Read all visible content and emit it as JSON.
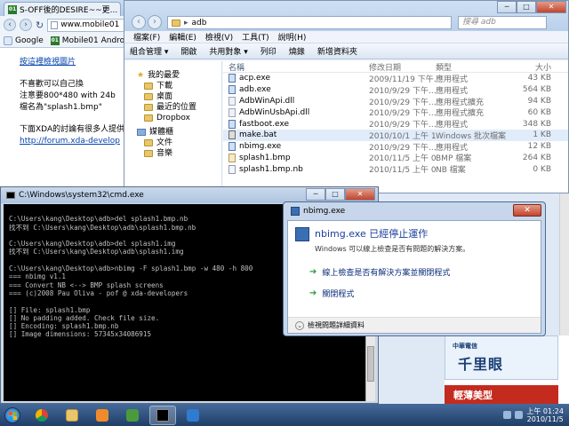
{
  "browser": {
    "tab_title": "S-OFF後的DESIRE~~更...",
    "tab_favicon": "01",
    "url": "www.mobile01",
    "bookmarks": [
      {
        "label": "Google",
        "icon": "google-icon"
      },
      {
        "label": "Mobile01 Android",
        "icon": "mobile01-icon"
      }
    ],
    "content": {
      "link1": "按這裡檢視圖片",
      "line1": "不喜歡可以自己換",
      "line2": "注意要800*480 with 24b",
      "line3": "檔名為\"splash1.bmp\"",
      "line4": "下面XDA的討論有很多人提供",
      "link2": "http://forum.xda-develop"
    }
  },
  "explorer": {
    "path": "adb",
    "search_placeholder": "搜尋 adb",
    "menu": [
      "檔案(F)",
      "編輯(E)",
      "檢視(V)",
      "工具(T)",
      "說明(H)"
    ],
    "commands": [
      "組合管理 ▾",
      "開啟",
      "共用對象 ▾",
      "列印",
      "燒錄",
      "新增資料夾"
    ],
    "nav": [
      {
        "label": "我的最愛",
        "icon": "star-icon",
        "sub": false
      },
      {
        "label": "下載",
        "icon": "folder-icon",
        "sub": true
      },
      {
        "label": "桌面",
        "icon": "folder-icon",
        "sub": true
      },
      {
        "label": "最近的位置",
        "icon": "folder-icon",
        "sub": true
      },
      {
        "label": "Dropbox",
        "icon": "folder-icon",
        "sub": true
      },
      {
        "label": "媒體櫃",
        "icon": "library-icon",
        "sub": false
      },
      {
        "label": "文件",
        "icon": "folder-icon",
        "sub": true
      },
      {
        "label": "音樂",
        "icon": "folder-icon",
        "sub": true
      }
    ],
    "columns": {
      "name": "名稱",
      "date": "修改日期",
      "type": "類型",
      "size": "大小"
    },
    "files": [
      {
        "name": "acp.exe",
        "date": "2009/11/19 下午...",
        "type": "應用程式",
        "size": "43 KB",
        "kind": "exe"
      },
      {
        "name": "adb.exe",
        "date": "2010/9/29 下午...",
        "type": "應用程式",
        "size": "564 KB",
        "kind": "exe"
      },
      {
        "name": "AdbWinApi.dll",
        "date": "2010/9/29 下午...",
        "type": "應用程式擴充",
        "size": "94 KB",
        "kind": "dll"
      },
      {
        "name": "AdbWinUsbApi.dll",
        "date": "2010/9/29 下午...",
        "type": "應用程式擴充",
        "size": "60 KB",
        "kind": "dll"
      },
      {
        "name": "fastboot.exe",
        "date": "2010/9/29 下午...",
        "type": "應用程式",
        "size": "348 KB",
        "kind": "exe"
      },
      {
        "name": "make.bat",
        "date": "2010/10/1 上午 1...",
        "type": "Windows 批次檔案",
        "size": "1 KB",
        "kind": "bat"
      },
      {
        "name": "nbimg.exe",
        "date": "2010/9/29 下午...",
        "type": "應用程式",
        "size": "12 KB",
        "kind": "exe"
      },
      {
        "name": "splash1.bmp",
        "date": "2010/11/5 上午 0...",
        "type": "BMP 檔案",
        "size": "264 KB",
        "kind": "bmp"
      },
      {
        "name": "splash1.bmp.nb",
        "date": "2010/11/5 上午 0...",
        "type": "NB 檔案",
        "size": "0 KB",
        "kind": "nb"
      }
    ],
    "selected_index": 5
  },
  "cmd": {
    "title": "C:\\Windows\\system32\\cmd.exe",
    "lines": [
      "",
      "C:\\Users\\kang\\Desktop\\adb>del splash1.bmp.nb",
      "找不到 C:\\Users\\kang\\Desktop\\adb\\splash1.bmp.nb",
      "",
      "C:\\Users\\kang\\Desktop\\adb>del splash1.img",
      "找不到 C:\\Users\\kang\\Desktop\\adb\\splash1.img",
      "",
      "C:\\Users\\kang\\Desktop\\adb>nbimg -F splash1.bmp -w 480 -h 800",
      "=== nbimg v1.1",
      "=== Convert NB <--> BMP splash screens",
      "=== (c)2008 Pau Oliva - pof @ xda-developers",
      "",
      "[] File: splash1.bmp",
      "[] No padding added. Check file size.",
      "[] Encoding: splash1.bmp.nb",
      "[] Image dimensions: 57345x34086915"
    ]
  },
  "dialog": {
    "title": "nbimg.exe",
    "heading": "nbimg.exe 已經停止運作",
    "description": "Windows 可以線上檢查是否有問題的解決方案。",
    "option1": "線上檢查是否有解決方案並關閉程式",
    "option2": "關閉程式",
    "details": "檢視問題詳細資料"
  },
  "ads": {
    "ad1_top": "中華電信",
    "ad1_big": "千里眼",
    "ad2": "輕薄美型"
  },
  "taskbar": {
    "time": "上午 01:24",
    "date": "2010/11/5"
  }
}
